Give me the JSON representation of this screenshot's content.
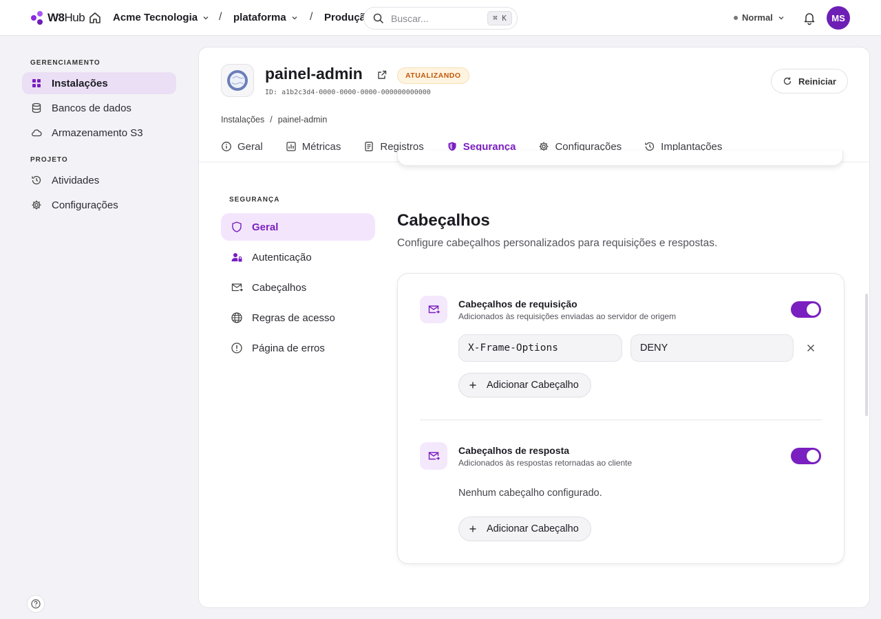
{
  "header": {
    "logo_text": "W8",
    "logo_text_thin": "Hub",
    "org": "Acme Tecnologia",
    "project": "plataforma",
    "environment_crumb": "Produção",
    "search_placeholder": "Buscar...",
    "search_shortcut": "⌘ K",
    "mode": "Normal",
    "avatar_initials": "MS"
  },
  "sidebar": {
    "section1": "GERENCIAMENTO",
    "items1": [
      {
        "label": "Instalações",
        "icon": "grid-icon",
        "active": true
      },
      {
        "label": "Bancos de dados",
        "icon": "database-icon"
      },
      {
        "label": "Armazenamento S3",
        "icon": "cloud-icon"
      }
    ],
    "section2": "PROJETO",
    "items2": [
      {
        "label": "Atividades",
        "icon": "history-icon"
      },
      {
        "label": "Configurações",
        "icon": "gear-icon"
      }
    ]
  },
  "app": {
    "name": "painel-admin",
    "status": "ATUALIZANDO",
    "id": "ID: a1b2c3d4-0000-0000-0000-000000000000",
    "restart_label": "Reiniciar",
    "breadcrumb": [
      "Instalações",
      "/",
      "painel-admin"
    ]
  },
  "tabs": [
    {
      "label": "Geral",
      "icon": "info-icon"
    },
    {
      "label": "Métricas",
      "icon": "chart-icon"
    },
    {
      "label": "Registros",
      "icon": "file-text-icon"
    },
    {
      "label": "Segurança",
      "icon": "shield-icon",
      "active": true
    },
    {
      "label": "Configurações",
      "icon": "gear-icon"
    },
    {
      "label": "Implantações",
      "icon": "history-icon"
    }
  ],
  "security_nav": {
    "title": "SEGURANÇA",
    "items": [
      {
        "label": "Geral",
        "icon": "shield-icon",
        "active": true
      },
      {
        "label": "Autenticação",
        "icon": "user-lock-icon"
      },
      {
        "label": "Cabeçalhos",
        "icon": "mail-forward-icon"
      },
      {
        "label": "Regras de acesso",
        "icon": "globe-icon"
      },
      {
        "label": "Página de erros",
        "icon": "alert-circle-icon"
      }
    ]
  },
  "headers_section": {
    "title": "Cabeçalhos",
    "subtitle": "Configure cabeçalhos personalizados para requisições e respostas.",
    "request": {
      "title": "Cabeçalhos de requisição",
      "description": "Adicionados às requisições enviadas ao servidor de origem",
      "enabled": true,
      "rows": [
        {
          "name": "X-Frame-Options",
          "value": "DENY"
        }
      ],
      "add_label": "Adicionar Cabeçalho"
    },
    "response": {
      "title": "Cabeçalhos de resposta",
      "description": "Adicionados às respostas retornadas ao cliente",
      "enabled": true,
      "empty_text": "Nenhum cabeçalho configurado.",
      "add_label": "Adicionar Cabeçalho"
    }
  },
  "colors": {
    "accent": "#7a1fc0",
    "badge_text": "#c2570c",
    "badge_bg": "#fff4e0"
  }
}
